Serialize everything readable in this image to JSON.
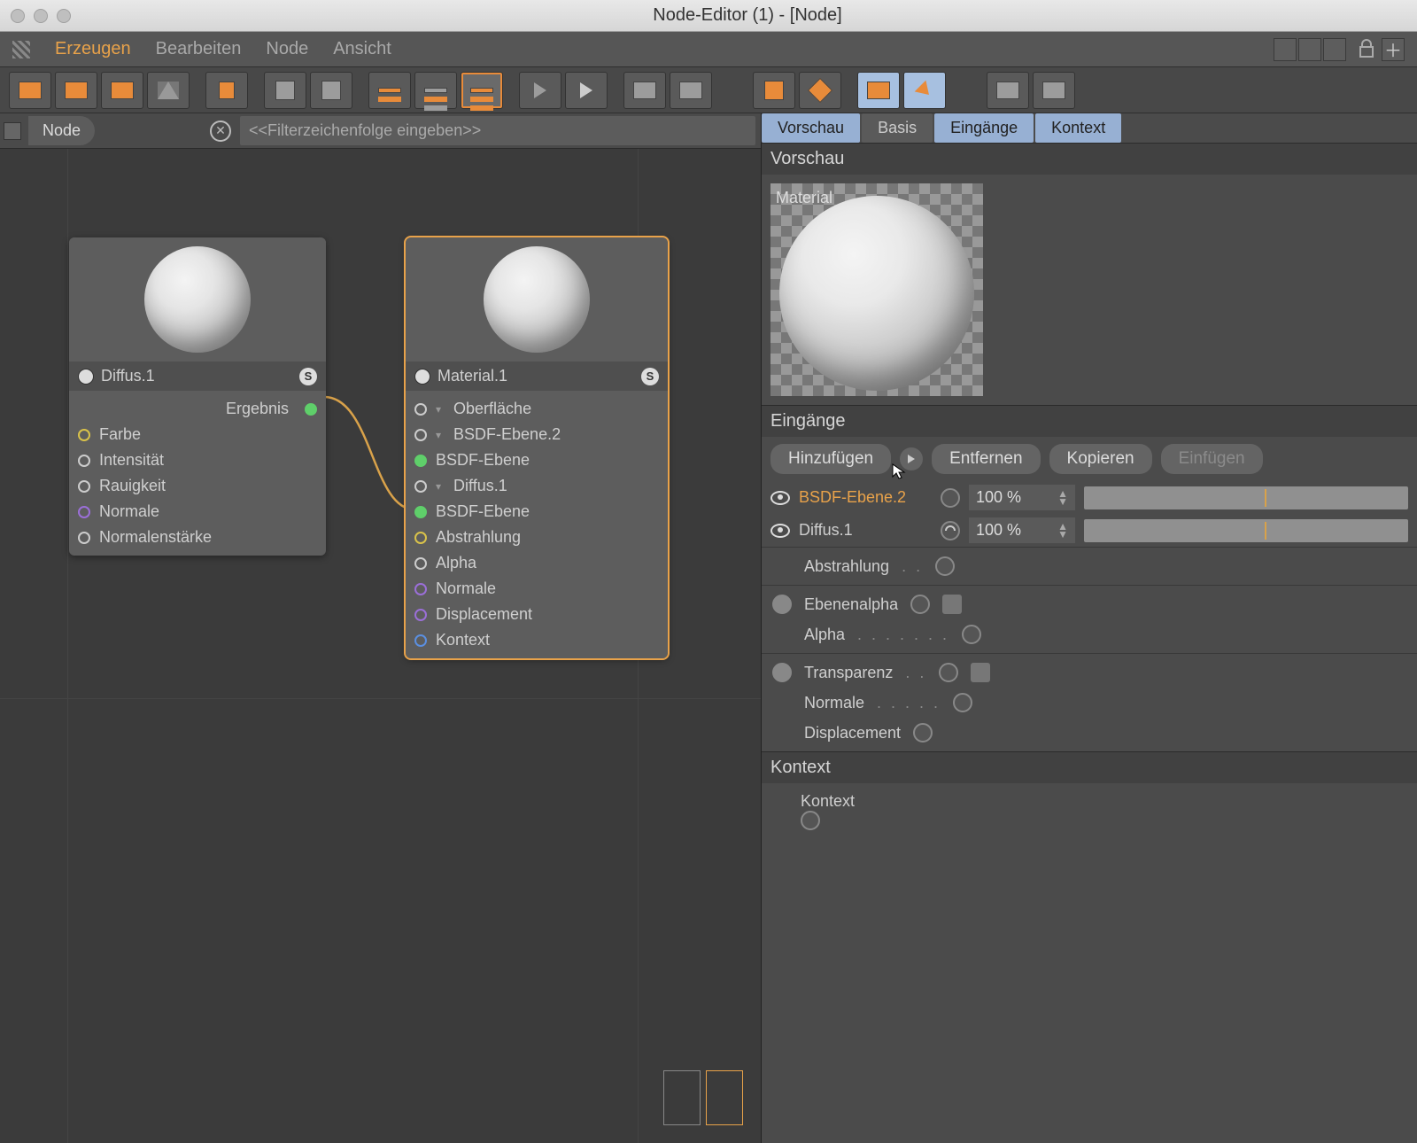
{
  "window": {
    "title": "Node-Editor (1) - [Node]"
  },
  "menu": {
    "items": [
      "Erzeugen",
      "Bearbeiten",
      "Node",
      "Ansicht"
    ],
    "active_index": 0
  },
  "breadcrumb": "Node",
  "filter_placeholder": "<<Filterzeichenfolge eingeben>>",
  "nodes": {
    "diffus": {
      "title": "Diffus.1",
      "output": "Ergebnis",
      "inputs": [
        "Farbe",
        "Intensität",
        "Rauigkeit",
        "Normale",
        "Normalenstärke"
      ]
    },
    "material": {
      "title": "Material.1",
      "rows": [
        {
          "label": "Oberfläche",
          "caret": true
        },
        {
          "label": "BSDF-Ebene.2",
          "caret": true,
          "indent": 1
        },
        {
          "label": "BSDF-Ebene",
          "indent": 2,
          "green": true
        },
        {
          "label": "Diffus.1",
          "caret": true,
          "indent": 1
        },
        {
          "label": "BSDF-Ebene",
          "indent": 2,
          "green": true
        },
        {
          "label": "Abstrahlung",
          "color": "y"
        },
        {
          "label": "Alpha"
        },
        {
          "label": "Normale",
          "color": "p"
        },
        {
          "label": "Displacement",
          "color": "p"
        },
        {
          "label": "Kontext",
          "color": "b"
        }
      ]
    }
  },
  "tabs": [
    "Vorschau",
    "Basis",
    "Eingänge",
    "Kontext"
  ],
  "tabs_active": [
    0,
    2,
    3
  ],
  "sections": {
    "preview": "Vorschau",
    "preview_label": "Material",
    "inputs": "Eingänge",
    "context": "Kontext"
  },
  "input_buttons": {
    "add": "Hinzufügen",
    "remove": "Entfernen",
    "copy": "Kopieren",
    "paste": "Einfügen"
  },
  "input_rows": [
    {
      "label": "BSDF-Ebene.2",
      "highlight": true,
      "pct": "100 %"
    },
    {
      "label": "Diffus.1",
      "highlight": false,
      "pct": "100 %"
    }
  ],
  "prop_rows": [
    {
      "group": true,
      "left": "",
      "label": "Abstrahlung",
      "dots": ". ."
    },
    {
      "group": true,
      "left": "radio",
      "label": "Ebenenalpha",
      "extra": "square"
    },
    {
      "left": "",
      "label": "Alpha",
      "dots": ". . . . . . ."
    },
    {
      "group": true,
      "left": "radio",
      "label": "Transparenz",
      "dots": ". .",
      "extra": "square"
    },
    {
      "left": "",
      "label": "Normale",
      "dots": ". . . . ."
    },
    {
      "left": "",
      "label": "Displacement"
    }
  ],
  "context_row": {
    "label": "Kontext"
  }
}
